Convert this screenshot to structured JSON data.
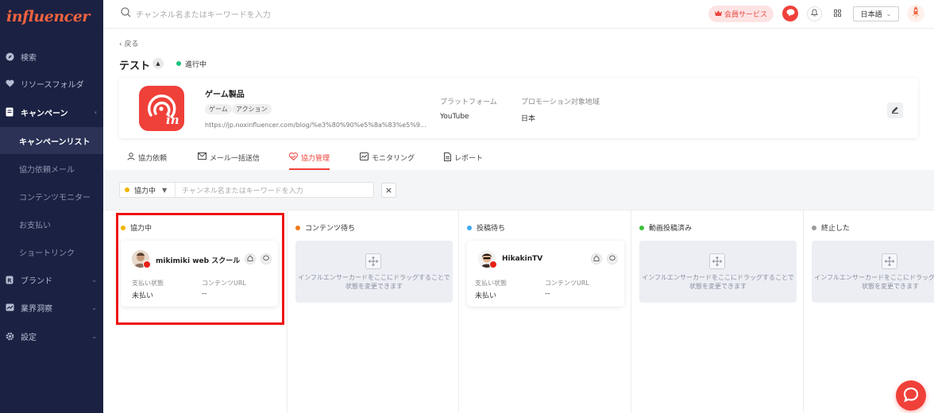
{
  "app": {
    "logo_text": "influencer"
  },
  "sidebar": {
    "items": [
      {
        "label": "検索"
      },
      {
        "label": "リソースフォルダ"
      },
      {
        "label": "キャンペーン"
      },
      {
        "label": "キャンペーンリスト"
      },
      {
        "label": "協力依頼メール"
      },
      {
        "label": "コンテンツモニター"
      },
      {
        "label": "お支払い"
      },
      {
        "label": "ショートリンク"
      },
      {
        "label": "ブランド"
      },
      {
        "label": "業界洞察"
      },
      {
        "label": "設定"
      }
    ]
  },
  "topbar": {
    "search_placeholder": "チャンネル名またはキーワードを入力",
    "member_label": "会員サービス",
    "language": "日本語"
  },
  "header": {
    "back_label": "戻る",
    "title": "テスト",
    "status": "進行中"
  },
  "product": {
    "name": "ゲーム製品",
    "tags": [
      "ゲーム",
      "アクション"
    ],
    "url": "https://jp.noxinfluencer.com/blog/%e3%80%90%e5%8a%83%e5%9...",
    "platform_label": "プラットフォーム",
    "platform_value": "YouTube",
    "region_label": "プロモーション対象地域",
    "region_value": "日本"
  },
  "tabs": [
    {
      "label": "協力依頼"
    },
    {
      "label": "メール一括送信"
    },
    {
      "label": "協力管理"
    },
    {
      "label": "モニタリング"
    },
    {
      "label": "レポート"
    }
  ],
  "filter": {
    "status": "協力中",
    "placeholder": "チャンネル名またはキーワードを入力",
    "clear": "×"
  },
  "board": {
    "columns": [
      {
        "title": "協力中",
        "color": "#f0b400"
      },
      {
        "title": "コンテンツ待ち",
        "color": "#f07a1a"
      },
      {
        "title": "投稿待ち",
        "color": "#3fa9f5"
      },
      {
        "title": "動画投稿済み",
        "color": "#3cc13b"
      },
      {
        "title": "終止した",
        "color": "#9a9a9a"
      }
    ],
    "cards": [
      {
        "name": "mikimiki web スクール",
        "pay_label": "支払い状態",
        "pay_value": "未払い",
        "url_label": "コンテンツURL",
        "url_value": "--"
      },
      {
        "name": "HikakinTV",
        "pay_label": "支払い状態",
        "pay_value": "未払い",
        "url_label": "コンテンツURL",
        "url_value": "--"
      }
    ],
    "drop_text": "インフルエンサーカードをここにドラッグすることで状態を変更できます"
  },
  "colors": {
    "accent": "#f0403a",
    "sidebar_bg": "#1b2142"
  }
}
